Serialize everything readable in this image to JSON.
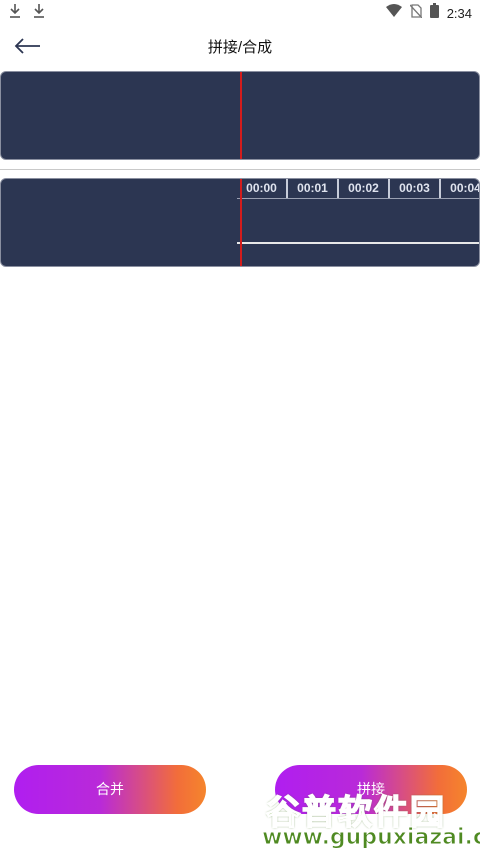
{
  "status_bar": {
    "time": "2:34",
    "left_icons": [
      "download-icon",
      "download-icon"
    ],
    "right_icons": [
      "wifi-icon",
      "no-sim-icon",
      "battery-icon"
    ]
  },
  "app_bar": {
    "title": "拼接/合成",
    "back_icon": "back-arrow-icon"
  },
  "timeline": {
    "ticks": [
      "00:00",
      "00:01",
      "00:02",
      "00:03",
      "00:04"
    ]
  },
  "buttons": {
    "merge_label": "合并",
    "splice_label": "拼接"
  },
  "watermark": {
    "title": "谷普软件园",
    "url": "www.gupuxiazai.com"
  },
  "colors": {
    "panel_bg": "#2c3652",
    "playhead": "#d41c1c",
    "gradient_start": "#b01ef0",
    "gradient_end": "#f5852c"
  }
}
